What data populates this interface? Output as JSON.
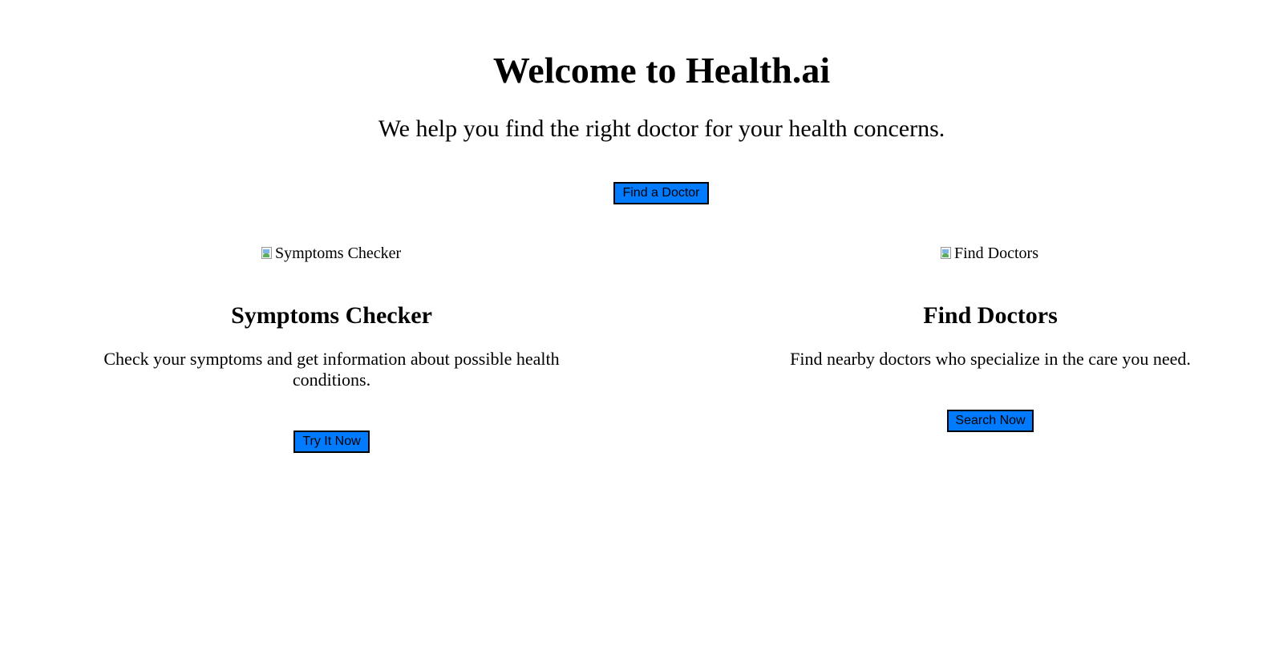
{
  "hero": {
    "title": "Welcome to Health.ai",
    "subtitle": "We help you find the right doctor for your health concerns.",
    "cta_label": "Find a Doctor"
  },
  "features": [
    {
      "image_alt": "Symptoms Checker",
      "title": "Symptoms Checker",
      "description": "Check your symptoms and get information about possible health conditions.",
      "button_label": "Try It Now"
    },
    {
      "image_alt": "Find Doctors",
      "title": "Find Doctors",
      "description": "Find nearby doctors who specialize in the care you need.",
      "button_label": "Search Now"
    }
  ],
  "colors": {
    "button_background": "#007bff",
    "button_border": "#000000",
    "text": "#000000",
    "background": "#ffffff"
  },
  "icons": {
    "broken_image": "broken-image-icon"
  }
}
